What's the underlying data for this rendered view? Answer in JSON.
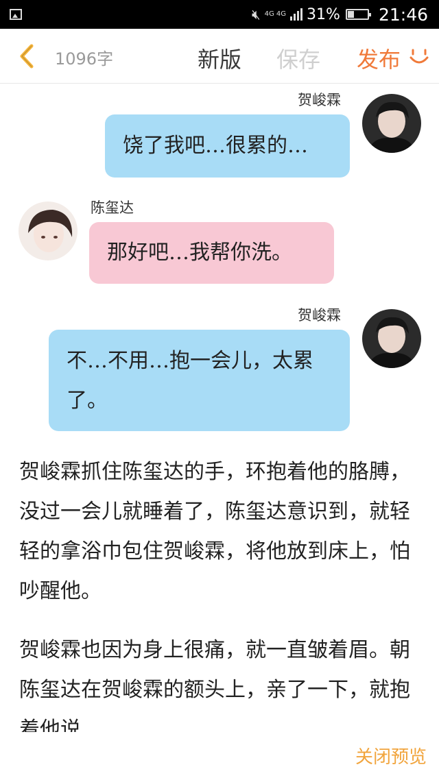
{
  "status_bar": {
    "network": "4G 4G",
    "battery_level_percent": 31,
    "battery_text": "31%",
    "time": "21:46"
  },
  "toolbar": {
    "word_count": "1096字",
    "new_version": "新版",
    "save": "保存",
    "publish": "发布",
    "colors": {
      "publish": "#f07a3a",
      "save_disabled": "#cfcfcf",
      "back": "#f5b43c"
    }
  },
  "chat": [
    {
      "name": "贺峻霖",
      "text": "饶了我吧…很累的…",
      "side": "right",
      "color": "#a8dcf6"
    },
    {
      "name": "陈玺达",
      "text": "那好吧…我帮你洗。",
      "side": "left",
      "color": "#f8c8d4"
    },
    {
      "name": "贺峻霖",
      "text": "不…不用…抱一会儿，太累了。",
      "side": "right",
      "color": "#a8dcf6"
    }
  ],
  "story": [
    "贺峻霖抓住陈玺达的手，环抱着他的胳膊，没过一会儿就睡着了，陈玺达意识到，就轻轻的拿浴巾包住贺峻霖，将他放到床上，怕吵醒他。",
    "贺峻霖也因为身上很痛，就一直皱着眉。朝陈玺达在贺峻霖的额头上，亲了一下，就抱着他说"
  ],
  "footer": {
    "close_preview": "关闭预览"
  },
  "icons": {
    "status_image": "image-icon",
    "mute": "mute-icon",
    "back": "chevron-left-icon",
    "smile": "smile-icon"
  }
}
